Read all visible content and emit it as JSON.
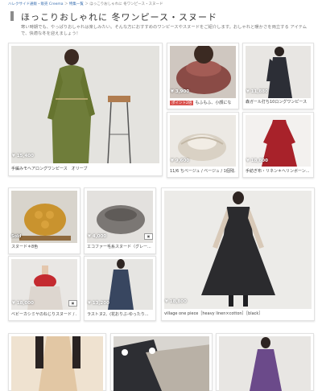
{
  "breadcrumb": {
    "home": "ハレクサイド通販・販売 Creema",
    "sep1": " ＞ ",
    "list": "特集一覧",
    "sep2": " ＞ ",
    "current": "ほっこりおしゃれに 冬ワンピース・スヌード"
  },
  "page": {
    "title": "ほっこりおしゃれに 冬ワンピース・スヌード",
    "description": "寒い時期でも、やっぱりおしゃれは楽しみたい。そんな方におすすめのワンピースやスヌードをご紹介します。おしゃれと暖かさを両立する アイテムで、快適な冬を迎えましょう！"
  },
  "items": [
    {
      "price": "¥ 15,400",
      "caption": "手編みモヘアロングワンピース　オリーブ"
    },
    {
      "price": "¥ 3,900",
      "badge": "ポイント2倍",
      "caption": "もふもふ、小顔にな"
    },
    {
      "price": "¥ 11,880",
      "caption": "森ガール打ち10ロングワンピース"
    },
    {
      "price": "¥ 9,600",
      "caption": "11/6 ちべージュ / ベージュ / 1個残..."
    },
    {
      "price": "¥ 18,800",
      "caption": "手紡ぎ布・リネン＊ヘリンボーン..."
    },
    {
      "sold": "Sold",
      "caption": "スヌード＊8色"
    },
    {
      "price": "¥ 4,000",
      "caption": "エコファー毛糸スヌード（グレー..."
    },
    {
      "price": "¥ 18,000",
      "caption": "ベビーカシミヤのねじりスヌード / ..."
    },
    {
      "price": "¥ 13,200",
      "caption": "ラストヌ2、(花おりぶ-ゆったり..."
    },
    {
      "price": "¥ 18,800",
      "caption": "village one piece［heavy linen×cotton］［black］"
    },
    {
      "caption": ""
    },
    {
      "caption": ""
    },
    {
      "caption": ""
    }
  ],
  "icons": {
    "photo_count": "pictures-icon"
  }
}
